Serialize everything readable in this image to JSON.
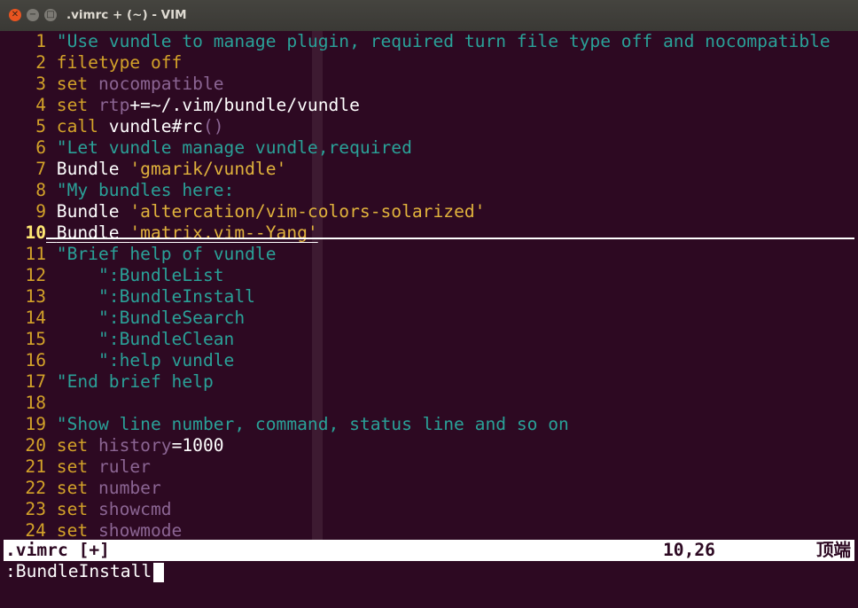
{
  "window": {
    "title": ".vimrc + (~) - VIM",
    "close_glyph": "✕",
    "min_glyph": "−",
    "max_glyph": "□"
  },
  "lines": [
    {
      "n": "1",
      "parts": [
        [
          "c",
          "\"Use vundle to manage plugin, required turn file type off and nocompatible"
        ]
      ]
    },
    {
      "n": "2",
      "parts": [
        [
          "s",
          "filetype"
        ],
        [
          "p",
          " "
        ],
        [
          "s",
          "off"
        ]
      ]
    },
    {
      "n": "3",
      "parts": [
        [
          "s",
          "set"
        ],
        [
          "p",
          " "
        ],
        [
          "o",
          "nocompatible"
        ]
      ]
    },
    {
      "n": "4",
      "parts": [
        [
          "s",
          "set"
        ],
        [
          "p",
          " "
        ],
        [
          "o",
          "rtp"
        ],
        [
          "p",
          "+=~/.vim/bundle/vundle"
        ]
      ]
    },
    {
      "n": "5",
      "parts": [
        [
          "s",
          "call"
        ],
        [
          "p",
          " vundle#rc"
        ],
        [
          "o",
          "()"
        ]
      ]
    },
    {
      "n": "6",
      "parts": [
        [
          "c",
          "\"Let vundle manage vundle,required"
        ]
      ]
    },
    {
      "n": "7",
      "parts": [
        [
          "p",
          "Bundle "
        ],
        [
          "q",
          "'gmarik/vundle'"
        ]
      ]
    },
    {
      "n": "8",
      "parts": [
        [
          "c",
          "\"My bundles here:"
        ]
      ]
    },
    {
      "n": "9",
      "parts": [
        [
          "p",
          "Bundle "
        ],
        [
          "q",
          "'altercation/vim-colors-solarized'"
        ]
      ]
    },
    {
      "n": "10",
      "current": true,
      "parts": [
        [
          "p",
          "Bundle "
        ],
        [
          "q",
          "'matrix.vim--Yang'"
        ]
      ]
    },
    {
      "n": "11",
      "parts": [
        [
          "c",
          "\"Brief help of vundle"
        ]
      ]
    },
    {
      "n": "12",
      "parts": [
        [
          "c",
          "    \":BundleList"
        ]
      ]
    },
    {
      "n": "13",
      "parts": [
        [
          "c",
          "    \":BundleInstall"
        ]
      ]
    },
    {
      "n": "14",
      "parts": [
        [
          "c",
          "    \":BundleSearch"
        ]
      ]
    },
    {
      "n": "15",
      "parts": [
        [
          "c",
          "    \":BundleClean"
        ]
      ]
    },
    {
      "n": "16",
      "parts": [
        [
          "c",
          "    \":help vundle"
        ]
      ]
    },
    {
      "n": "17",
      "parts": [
        [
          "c",
          "\"End brief help"
        ]
      ]
    },
    {
      "n": "18",
      "parts": []
    },
    {
      "n": "19",
      "parts": [
        [
          "c",
          "\"Show line number, command, status line and so on"
        ]
      ]
    },
    {
      "n": "20",
      "parts": [
        [
          "s",
          "set"
        ],
        [
          "p",
          " "
        ],
        [
          "o",
          "history"
        ],
        [
          "p",
          "=1000"
        ]
      ]
    },
    {
      "n": "21",
      "parts": [
        [
          "s",
          "set"
        ],
        [
          "p",
          " "
        ],
        [
          "o",
          "ruler"
        ]
      ]
    },
    {
      "n": "22",
      "parts": [
        [
          "s",
          "set"
        ],
        [
          "p",
          " "
        ],
        [
          "o",
          "number"
        ]
      ]
    },
    {
      "n": "23",
      "parts": [
        [
          "s",
          "set"
        ],
        [
          "p",
          " "
        ],
        [
          "o",
          "showcmd"
        ]
      ]
    },
    {
      "n": "24",
      "parts": [
        [
          "s",
          "set"
        ],
        [
          "p",
          " "
        ],
        [
          "o",
          "showmode"
        ]
      ]
    }
  ],
  "statusline": {
    "filename": ".vimrc [+]",
    "position": "10,26",
    "scroll": "顶端"
  },
  "cmdline": {
    "text": ":BundleInstall"
  },
  "colors": {
    "background": "#2d0922",
    "comment": "#2aa198",
    "statement": "#d3a229",
    "option": "#8b6593",
    "string": "#e0b23c",
    "line_number": "#d3a229",
    "current_line_number": "#ffe873"
  }
}
